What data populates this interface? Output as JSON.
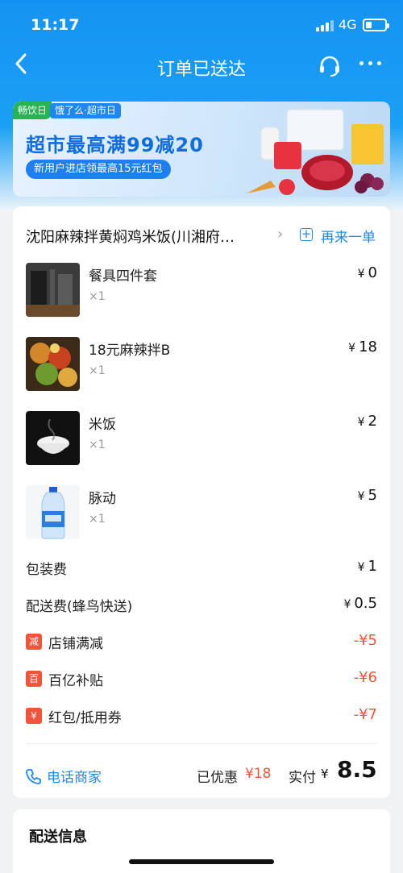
{
  "status": {
    "time": "11:17",
    "network": "4G"
  },
  "nav": {
    "title": "订单已送达"
  },
  "banner": {
    "tag_left": "畅饮日",
    "tag_right": "饿了么·超市日",
    "title": "超市最高满99减20",
    "subtitle": "新用户进店领最高15元红包"
  },
  "order": {
    "shop_name": "沈阳麻辣拌黄焖鸡米饭(川湘府…",
    "reorder_label": "再来一单",
    "currency": "¥",
    "items": [
      {
        "name": "餐具四件套",
        "qty": "×1",
        "price": "0"
      },
      {
        "name": "18元麻辣拌B",
        "qty": "×1",
        "price": "18"
      },
      {
        "name": "米饭",
        "qty": "×1",
        "price": "2"
      },
      {
        "name": "脉动",
        "qty": "×1",
        "price": "5"
      }
    ],
    "fees": [
      {
        "label": "包装费",
        "value": "1"
      },
      {
        "label": "配送费(蜂鸟快送)",
        "value": "0.5"
      }
    ],
    "discounts": [
      {
        "badge": "减",
        "label": "店铺满减",
        "value": "-¥5"
      },
      {
        "badge": "百",
        "label": "百亿补贴",
        "value": "-¥6"
      },
      {
        "badge": "¥",
        "label": "红包/抵用券",
        "value": "-¥7"
      }
    ],
    "phone_label": "电话商家",
    "saved_label": "已优惠",
    "saved_value": "¥18",
    "paid_label": "实付",
    "paid_currency": "¥",
    "paid_value": "8.5"
  },
  "delivery": {
    "title": "配送信息"
  },
  "colors": {
    "accent": "#1e88f0",
    "discount": "#f1543a",
    "header": "#1593f2"
  }
}
